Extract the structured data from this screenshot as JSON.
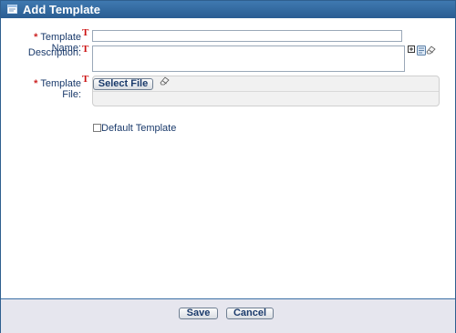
{
  "dialog": {
    "title": "Add Template"
  },
  "form": {
    "required_marker": "*",
    "translation_marker": "T",
    "template_name": {
      "label": "Template Name:",
      "value": "",
      "placeholder": ""
    },
    "description": {
      "label": "Description:",
      "value": "",
      "placeholder": ""
    },
    "template_file": {
      "label": "Template File:",
      "select_button": "Select File"
    },
    "default_template": {
      "label": "Default Template",
      "checked": false
    }
  },
  "footer": {
    "save": "Save",
    "cancel": "Cancel"
  },
  "colors": {
    "title_bar": "#2f64a0",
    "label_text": "#1a3a6b",
    "required": "#cc2222",
    "footer_bg": "#e6e6ee"
  }
}
